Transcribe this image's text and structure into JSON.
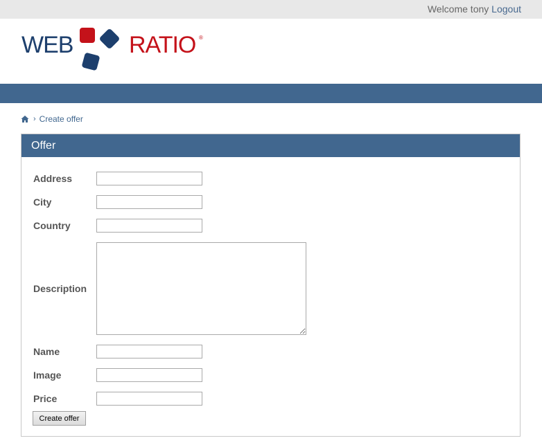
{
  "header": {
    "welcome_text": "Welcome tony",
    "logout_label": "Logout"
  },
  "logo": {
    "web": "WEB",
    "ratio": "RATIO",
    "registered": "®",
    "colors": {
      "blue": "#1d3f6d",
      "red": "#c4121a"
    }
  },
  "colors": {
    "nav_bar": "#41678f",
    "panel_header": "#41678f",
    "top_bar": "#e8e8e8"
  },
  "breadcrumb": {
    "home_icon": "home-icon",
    "separator": "›",
    "current": "Create offer"
  },
  "panel": {
    "title": "Offer"
  },
  "form": {
    "fields": [
      {
        "label": "Address",
        "value": ""
      },
      {
        "label": "City",
        "value": ""
      },
      {
        "label": "Country",
        "value": ""
      },
      {
        "label": "Description",
        "value": ""
      },
      {
        "label": "Name",
        "value": ""
      },
      {
        "label": "Image",
        "value": ""
      },
      {
        "label": "Price",
        "value": ""
      }
    ],
    "submit_label": "Create offer"
  }
}
